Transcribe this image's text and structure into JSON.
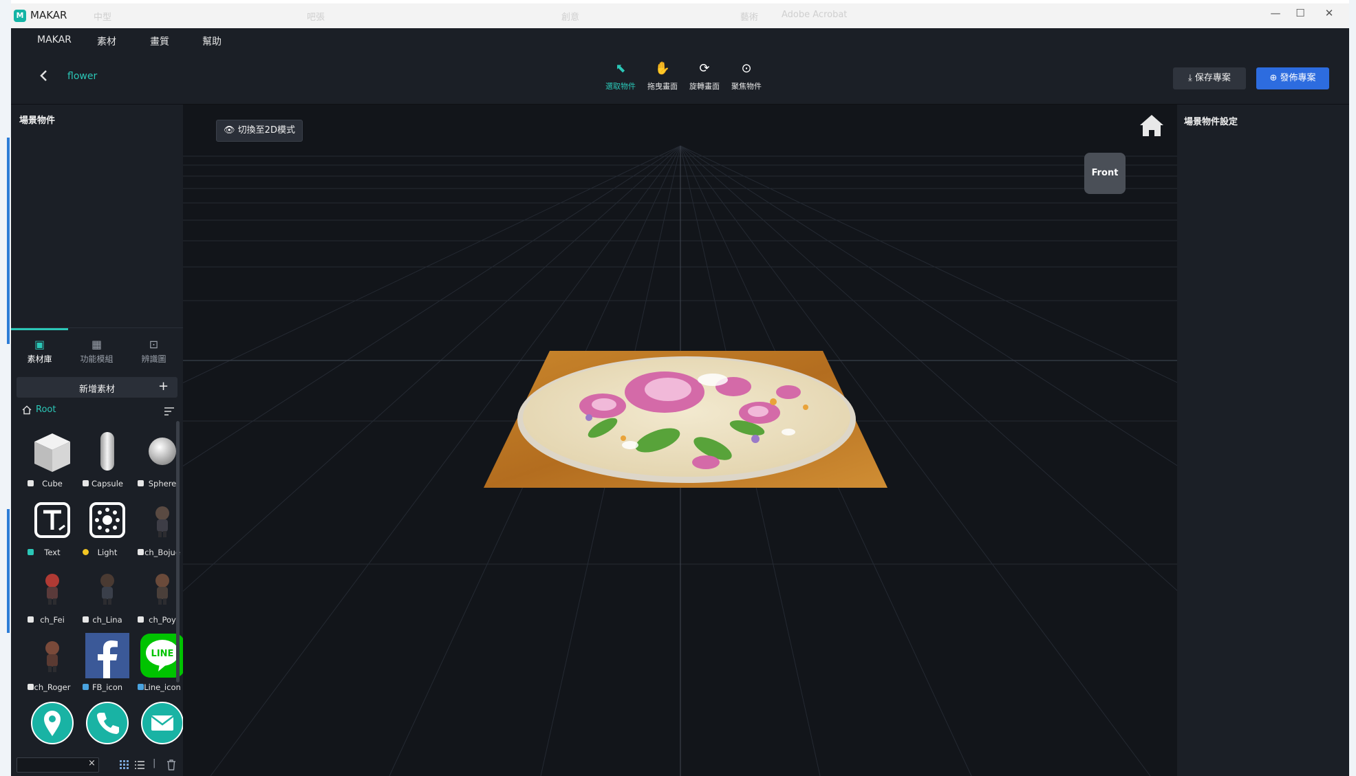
{
  "window": {
    "app_title": "MAKAR",
    "logo_text": "M",
    "faint_titles": [
      "中型",
      "吧張",
      "創意",
      "藝術",
      "Adobe Acrobat"
    ],
    "controls": {
      "minimize": "—",
      "maximize": "☐",
      "close": "✕"
    }
  },
  "menu": [
    "MAKAR",
    "素材",
    "畫質",
    "幫助"
  ],
  "toolbar": {
    "back_icon": "chevron-left-icon",
    "project_name": "flower",
    "tools": [
      {
        "icon": "cursor-icon",
        "glyph": "⬉",
        "label": "選取物件",
        "active": true
      },
      {
        "icon": "hand-icon",
        "glyph": "✋",
        "label": "拖曳畫面",
        "active": false
      },
      {
        "icon": "rotate-icon",
        "glyph": "⟳",
        "label": "旋轉畫面",
        "active": false
      },
      {
        "icon": "focus-icon",
        "glyph": "⊙",
        "label": "聚焦物件",
        "active": false
      }
    ],
    "save_label": "⤓ 保存專案",
    "publish_label": "⊕ 發佈專案"
  },
  "left_panel": {
    "scene_objects_title": "場景物件",
    "tabs": [
      {
        "label": "素材庫",
        "icon": "asset-library-icon",
        "glyph": "▣",
        "active": true
      },
      {
        "label": "功能模組",
        "icon": "module-icon",
        "glyph": "▦",
        "active": false
      },
      {
        "label": "辨識圖",
        "icon": "recognition-image-icon",
        "glyph": "⊡",
        "active": false
      }
    ],
    "add_asset_label": "新增素材",
    "add_asset_plus": "+",
    "root_label": "Root",
    "assets": [
      {
        "label": "Cube",
        "kind": "cube"
      },
      {
        "label": "Capsule",
        "kind": "capsule"
      },
      {
        "label": "Sphere",
        "kind": "sphere"
      },
      {
        "label": "Text",
        "kind": "text"
      },
      {
        "label": "Light",
        "kind": "light"
      },
      {
        "label": "ch_Bojue",
        "kind": "char"
      },
      {
        "label": "ch_Fei",
        "kind": "char-red"
      },
      {
        "label": "ch_Lina",
        "kind": "char"
      },
      {
        "label": "ch_Poy",
        "kind": "char"
      },
      {
        "label": "ch_Roger",
        "kind": "char"
      },
      {
        "label": "FB_icon",
        "kind": "facebook"
      },
      {
        "label": "Line_icon",
        "kind": "line"
      },
      {
        "label": "",
        "kind": "location"
      },
      {
        "label": "",
        "kind": "phone"
      },
      {
        "label": "",
        "kind": "mail"
      }
    ],
    "filter_clear": "×",
    "divider": "|"
  },
  "viewport": {
    "mode_button_label": "👁 切換至2D模式",
    "gizmo_label": "Front",
    "line_logo_text": "LINE"
  },
  "right_panel": {
    "title": "場景物件設定"
  },
  "colors": {
    "accent": "#2bc7b7",
    "publish": "#2d6cdf",
    "panel": "#1b1f26",
    "viewport": "#12151a"
  }
}
